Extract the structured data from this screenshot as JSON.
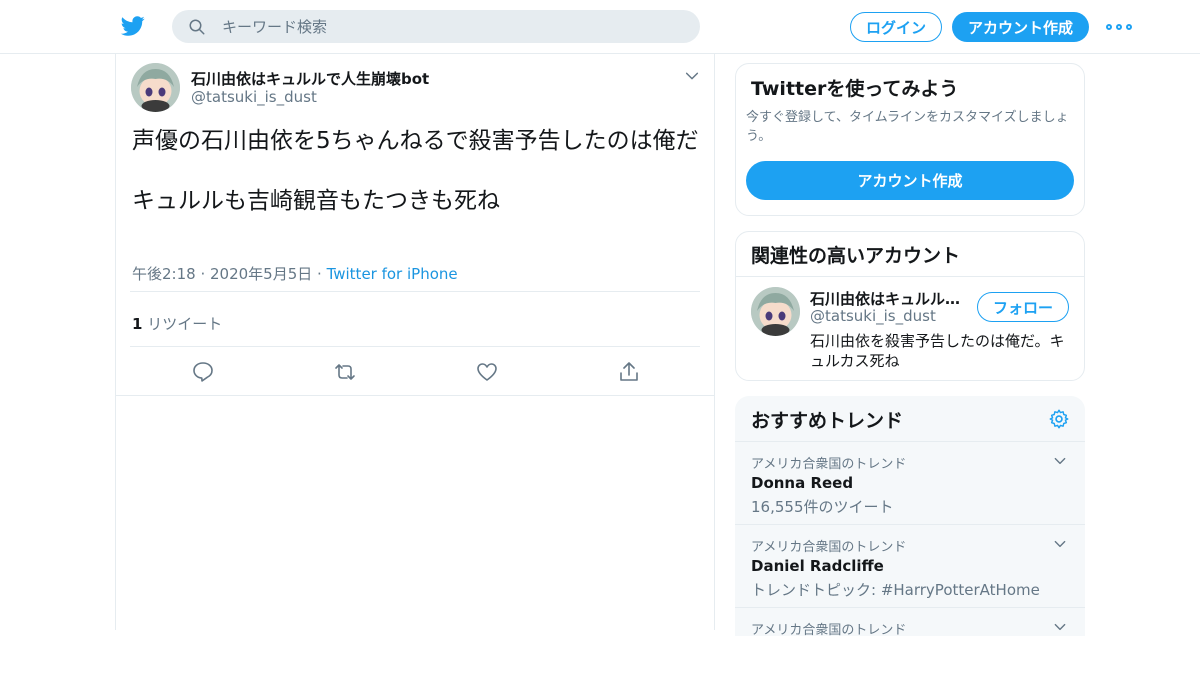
{
  "header": {
    "search_placeholder": "キーワード検索",
    "login_label": "ログイン",
    "signup_label": "アカウント作成"
  },
  "tweet": {
    "author_name": "石川由依はキュルルで人生崩壊bot",
    "author_handle": "@tatsuki_is_dust",
    "text": "声優の石川由依を5ちゃんねるで殺害予告したのは俺だ\n\nキュルルも吉崎観音もたつきも死ね",
    "timestamp": "午後2:18 · 2020年5月5日",
    "separator": " · ",
    "source": "Twitter for iPhone",
    "retweet_count": "1",
    "retweet_label": "リツイート"
  },
  "sidebar": {
    "promo": {
      "title": "Twitterを使ってみよう",
      "description": "今すぐ登録して、タイムラインをカスタマイズしましょう。",
      "button_label": "アカウント作成"
    },
    "related": {
      "title": "関連性の高いアカウント",
      "account_name": "石川由依はキュルルで人生崩壊bot",
      "account_handle": "@tatsuki_is_dust",
      "account_bio": "石川由依を殺害予告したのは俺だ。キュルカス死ね",
      "follow_label": "フォロー"
    },
    "trends": {
      "title": "おすすめトレンド",
      "items": [
        {
          "location": "アメリカ合衆国のトレンド",
          "name": "Donna Reed",
          "meta": "16,555件のツイート"
        },
        {
          "location": "アメリカ合衆国のトレンド",
          "name": "Daniel Radcliffe",
          "meta": "トレンドトピック: #HarryPotterAtHome"
        },
        {
          "location": "アメリカ合衆国のトレンド",
          "name": "",
          "meta": ""
        }
      ]
    }
  },
  "colors": {
    "accent": "#1da1f2",
    "text_primary": "#14171a",
    "text_secondary": "#657786",
    "border": "#e6ecf0"
  }
}
